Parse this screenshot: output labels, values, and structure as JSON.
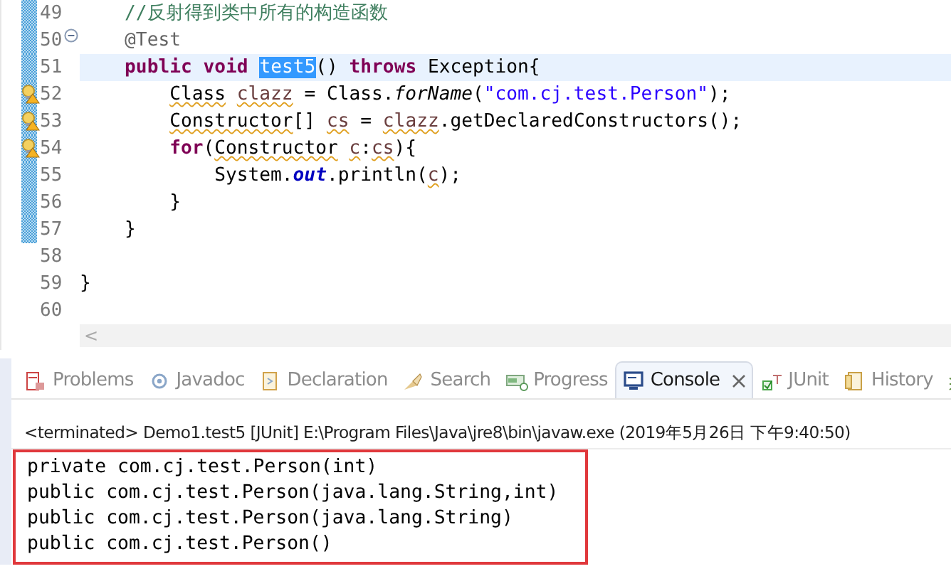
{
  "editor": {
    "lines": [
      {
        "number": "49",
        "changed": true,
        "warning": false,
        "current": false,
        "tokens": [
          {
            "kind": "comment",
            "text": "    //反射得到类中所有的构造函数"
          }
        ]
      },
      {
        "number": "50",
        "changed": true,
        "warning": false,
        "current": false,
        "fold": {
          "expanded": true
        },
        "tokens": [
          {
            "kind": "annotation",
            "text": "    @Test"
          }
        ]
      },
      {
        "number": "51",
        "changed": true,
        "warning": false,
        "current": true,
        "tokens": [
          {
            "kind": "keyword",
            "text": "    public"
          },
          {
            "kind": "keyword",
            "text": " void"
          },
          {
            "kind": "selected",
            "text": " test5"
          },
          {
            "kind": "plain",
            "text": "()"
          },
          {
            "kind": "keyword",
            "text": " throws"
          },
          {
            "kind": "plain",
            "text": " Exception{"
          }
        ]
      },
      {
        "number": "52",
        "changed": true,
        "warning": true,
        "current": false,
        "tokens": [
          {
            "kind": "squiggle",
            "text": "        Class"
          },
          {
            "kind": "variable",
            "text": " clazz"
          },
          {
            "kind": "plain",
            "text": " = Class."
          },
          {
            "kind": "static",
            "text": "forName"
          },
          {
            "kind": "plain",
            "text": "("
          },
          {
            "kind": "string",
            "text": "\"com.cj.test.Person\""
          },
          {
            "kind": "plain",
            "text": ");"
          }
        ]
      },
      {
        "number": "53",
        "changed": true,
        "warning": true,
        "current": false,
        "tokens": [
          {
            "kind": "squiggle",
            "text": "        Constructor"
          },
          {
            "kind": "plain",
            "text": "[]"
          },
          {
            "kind": "variable",
            "text": " cs"
          },
          {
            "kind": "plain",
            "text": " ="
          },
          {
            "kind": "variable",
            "text": " clazz"
          },
          {
            "kind": "plain",
            "text": ".getDeclaredConstructors();"
          }
        ]
      },
      {
        "number": "54",
        "changed": true,
        "warning": true,
        "current": false,
        "tokens": [
          {
            "kind": "keyword",
            "text": "        for"
          },
          {
            "kind": "plain",
            "text": "("
          },
          {
            "kind": "squiggle",
            "text": "Constructor"
          },
          {
            "kind": "variable",
            "text": " c"
          },
          {
            "kind": "plain",
            "text": ":"
          },
          {
            "kind": "variable",
            "text": "cs"
          },
          {
            "kind": "plain",
            "text": "){"
          }
        ]
      },
      {
        "number": "55",
        "changed": true,
        "warning": false,
        "current": false,
        "tokens": [
          {
            "kind": "plain",
            "text": "            System."
          },
          {
            "kind": "field",
            "text": "out"
          },
          {
            "kind": "plain",
            "text": ".println("
          },
          {
            "kind": "variable",
            "text": "c"
          },
          {
            "kind": "plain",
            "text": ");"
          }
        ]
      },
      {
        "number": "56",
        "changed": true,
        "warning": false,
        "current": false,
        "tokens": [
          {
            "kind": "plain",
            "text": "        }"
          }
        ]
      },
      {
        "number": "57",
        "changed": true,
        "warning": false,
        "current": false,
        "tokens": [
          {
            "kind": "plain",
            "text": "    }"
          }
        ]
      },
      {
        "number": "58",
        "changed": false,
        "warning": false,
        "current": false
      },
      {
        "number": "59",
        "changed": false,
        "warning": false,
        "current": false,
        "tokens": [
          {
            "kind": "plain",
            "text": "}"
          }
        ]
      },
      {
        "number": "60",
        "changed": false,
        "warning": false,
        "current": false
      }
    ],
    "scroll_left": "<"
  },
  "tabs": [
    {
      "label": "Problems",
      "selected": false
    },
    {
      "label": "Javadoc",
      "selected": false
    },
    {
      "label": "Declaration",
      "selected": false
    },
    {
      "label": "Search",
      "selected": false
    },
    {
      "label": "Progress",
      "selected": false
    },
    {
      "label": "Console",
      "selected": true
    },
    {
      "label": "JUnit",
      "selected": false
    },
    {
      "label": "History",
      "selected": false
    },
    {
      "selected": false
    }
  ],
  "console": {
    "status": "<terminated> Demo1.test5 [JUnit] E:\\Program Files\\Java\\jre8\\bin\\javaw.exe (2019年5月26日 下午9:40:50)",
    "output": [
      "private com.cj.test.Person(int)",
      "public com.cj.test.Person(java.lang.String,int)",
      "public com.cj.test.Person(java.lang.String)",
      "public com.cj.test.Person()"
    ]
  }
}
